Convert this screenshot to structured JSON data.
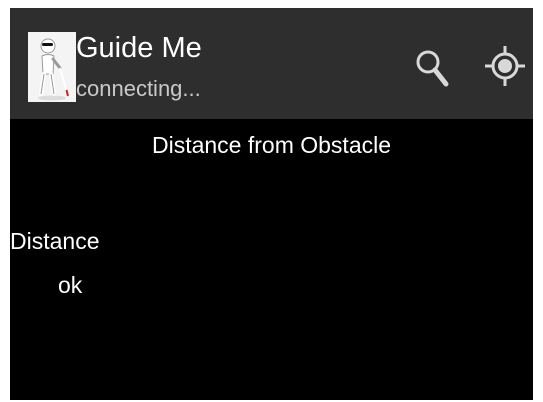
{
  "app_bar": {
    "title": "Guide Me",
    "subtitle": "connecting...",
    "icon": "blind-person-with-cane-icon",
    "actions": [
      "search-icon",
      "location-target-icon"
    ],
    "background": "#2e2e2e"
  },
  "main": {
    "heading": "Distance from Obstacle",
    "distance_label": "Distance",
    "distance_value": "ok",
    "background": "#000000"
  }
}
